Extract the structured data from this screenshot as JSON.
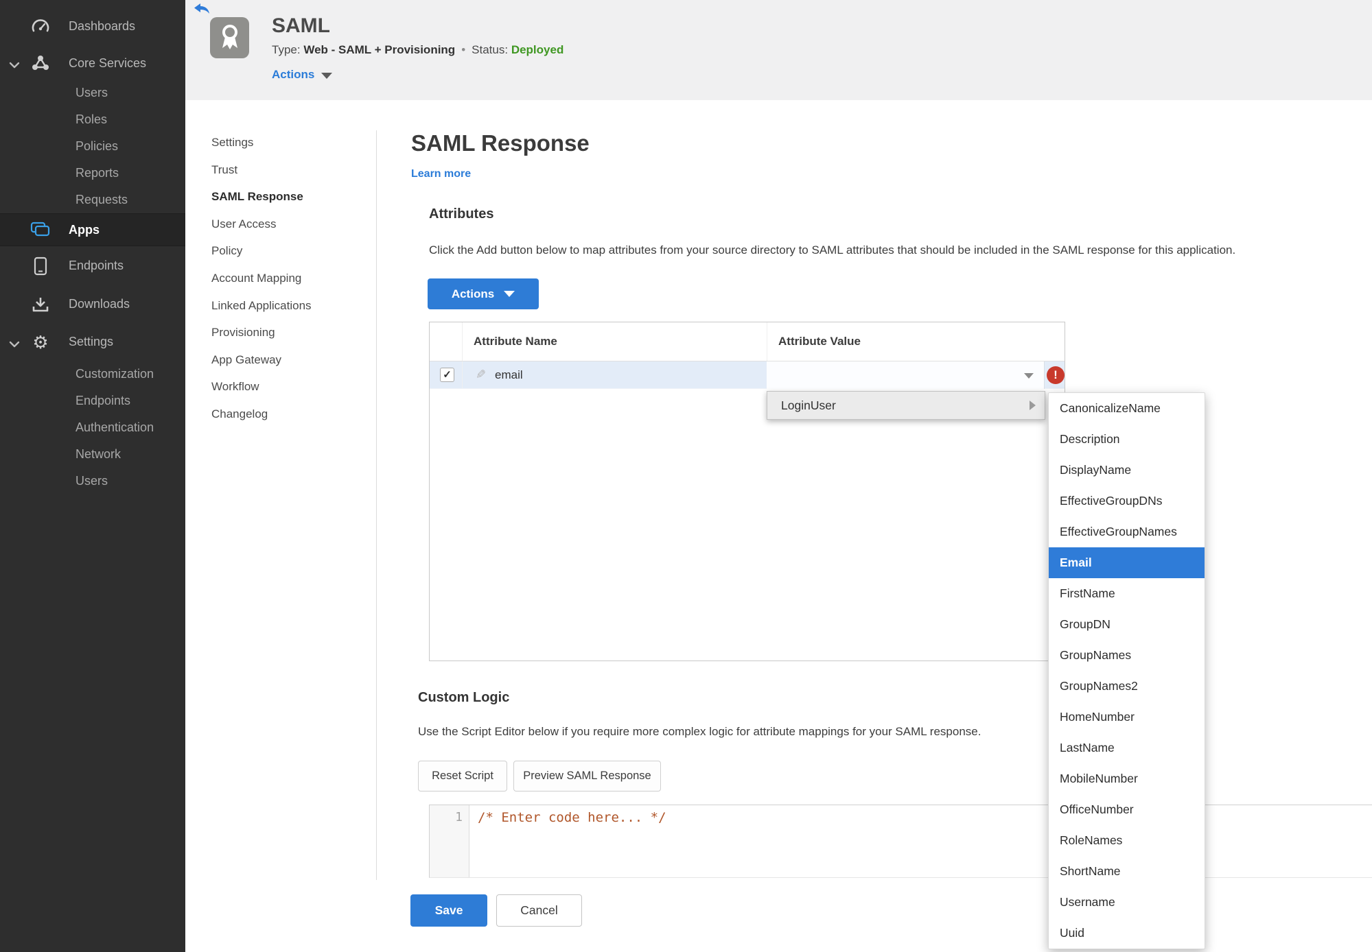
{
  "sidebar": {
    "items": [
      {
        "label": "Dashboards"
      },
      {
        "label": "Core Services"
      },
      {
        "label": "Users"
      },
      {
        "label": "Roles"
      },
      {
        "label": "Policies"
      },
      {
        "label": "Reports"
      },
      {
        "label": "Requests"
      },
      {
        "label": "Apps"
      },
      {
        "label": "Endpoints"
      },
      {
        "label": "Downloads"
      },
      {
        "label": "Settings"
      },
      {
        "label": "Customization"
      },
      {
        "label": "Endpoints"
      },
      {
        "label": "Authentication"
      },
      {
        "label": "Network"
      },
      {
        "label": "Users"
      }
    ]
  },
  "header": {
    "title": "SAML",
    "type_label": "Type:",
    "type_value": "Web - SAML + Provisioning",
    "separator": "•",
    "status_label": "Status:",
    "status_value": "Deployed",
    "actions_label": "Actions"
  },
  "subnav": {
    "items": [
      {
        "label": "Settings"
      },
      {
        "label": "Trust"
      },
      {
        "label": "SAML Response"
      },
      {
        "label": "User Access"
      },
      {
        "label": "Policy"
      },
      {
        "label": "Account Mapping"
      },
      {
        "label": "Linked Applications"
      },
      {
        "label": "Provisioning"
      },
      {
        "label": "App Gateway"
      },
      {
        "label": "Workflow"
      },
      {
        "label": "Changelog"
      }
    ],
    "active_item": "SAML Response"
  },
  "main": {
    "page_title": "SAML Response",
    "learn_more": "Learn more",
    "attributes": {
      "heading": "Attributes",
      "description": "Click the Add button below to map attributes from your source directory to SAML attributes that should be included in the SAML response for this application.",
      "actions_button": "Actions"
    },
    "table": {
      "columns": [
        "Attribute Name",
        "Attribute Value"
      ],
      "rows": [
        {
          "name": "email",
          "checked": true,
          "value": "",
          "check_glyph": "✓",
          "has_error": true,
          "error_glyph": "!"
        }
      ]
    },
    "custom_logic": {
      "heading": "Custom Logic",
      "description": "Use the Script Editor below if you require more complex logic for attribute mappings for your SAML response.",
      "reset_button": "Reset Script",
      "preview_button": "Preview SAML Response"
    },
    "editor": {
      "line_number": "1",
      "code": "/* Enter code here... */"
    },
    "save_button": "Save",
    "cancel_button": "Cancel"
  },
  "attribute_menu": {
    "parent_item": "LoginUser",
    "selected_item": "Email",
    "items": [
      "CanonicalizeName",
      "Description",
      "DisplayName",
      "EffectiveGroupDNs",
      "EffectiveGroupNames",
      "Email",
      "FirstName",
      "GroupDN",
      "GroupNames",
      "GroupNames2",
      "HomeNumber",
      "LastName",
      "MobileNumber",
      "OfficeNumber",
      "RoleNames",
      "ShortName",
      "Username",
      "Uuid"
    ]
  },
  "icons": {
    "sidebar": [
      "dashboard-gauge",
      "core-services-nodes",
      "apps-windows",
      "endpoints-phone",
      "downloads-tray",
      "settings-gear"
    ],
    "header": [
      "back-arrow",
      "ribbon-award"
    ],
    "misc": [
      "pencil-edit",
      "error-exclamation",
      "chevron-down",
      "caret-down",
      "submenu-arrow-right",
      "checkbox-check"
    ]
  },
  "colors": {
    "accent_blue": "#2e7cd6",
    "link_blue": "#2b7cd8",
    "status_green": "#3f9722",
    "error_red": "#c8392c",
    "code_comment": "#b0562a",
    "sidebar_bg": "#2e2e2e",
    "sidebar_active_bg": "#252525",
    "apps_icon_blue": "#3aa0e8",
    "header_bg": "#f0f0f1",
    "row_highlight": "#e3ecf8",
    "menu_hover_gray": "#ebebeb"
  }
}
